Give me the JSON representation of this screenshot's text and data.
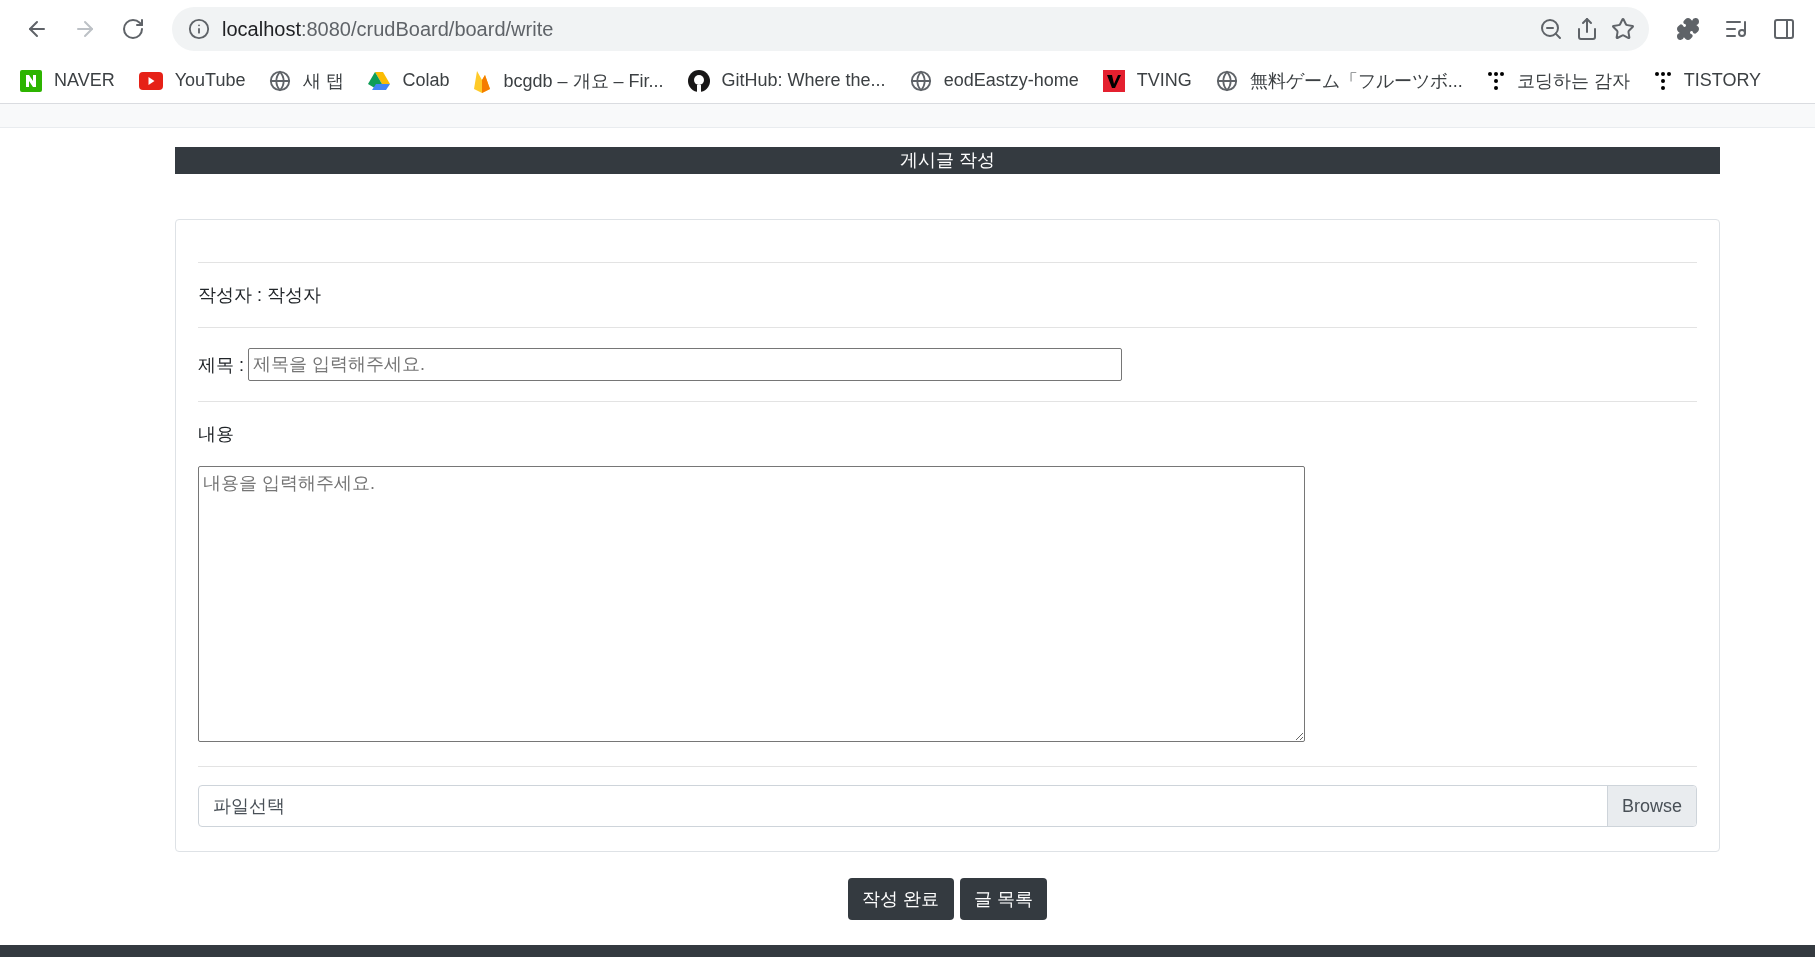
{
  "browser": {
    "url_host": "localhost",
    "url_path": ":8080/crudBoard/board/write"
  },
  "bookmarks": [
    {
      "kind": "naver",
      "label": "NAVER"
    },
    {
      "kind": "youtube",
      "label": "YouTube"
    },
    {
      "kind": "globe",
      "label": "새 탭"
    },
    {
      "kind": "drive",
      "label": "Colab"
    },
    {
      "kind": "firebase",
      "label": "bcgdb – 개요 – Fir..."
    },
    {
      "kind": "github",
      "label": "GitHub: Where the..."
    },
    {
      "kind": "globe",
      "label": "eodEastzy-home"
    },
    {
      "kind": "tving",
      "label": "TVING"
    },
    {
      "kind": "globe",
      "label": "無料ゲーム「フルーツボ..."
    },
    {
      "kind": "dots",
      "label": "코딩하는 감자"
    },
    {
      "kind": "dots",
      "label": "TISTORY"
    }
  ],
  "page": {
    "heading": "게시글 작성",
    "author": "작성자 : 작성자",
    "title_label": "제목 :",
    "title_placeholder": "제목을 입력해주세요.",
    "content_label": "내용",
    "content_placeholder": "내용을 입력해주세요.",
    "file_label": "파일선택",
    "browse": "Browse",
    "buttons": [
      "작성 완료",
      "글 목록"
    ]
  }
}
